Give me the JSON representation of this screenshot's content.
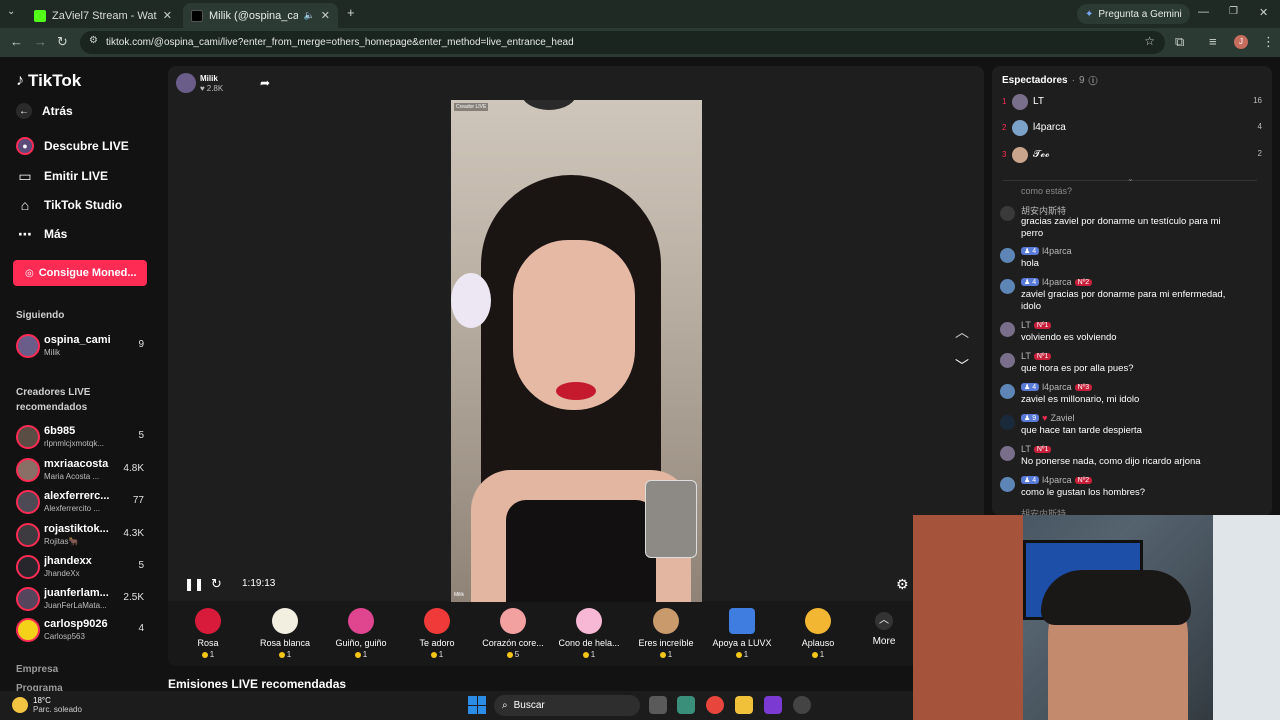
{
  "browser": {
    "tabs": [
      {
        "label": "ZaViel7 Stream - Watch Live on"
      },
      {
        "label": "Milik (@ospina_cami) está"
      }
    ],
    "gemini_label": "Pregunta a Gemini",
    "url": "tiktok.com/@ospina_cami/live?enter_from_merge=others_homepage&enter_method=live_entrance_head"
  },
  "sidebar": {
    "logo": "TikTok",
    "back": "Atrás",
    "nav": [
      {
        "label": "Descubre LIVE",
        "icon": "live-globe-icon"
      },
      {
        "label": "Emitir LIVE",
        "icon": "video-camera-icon"
      },
      {
        "label": "TikTok Studio",
        "icon": "home-icon"
      },
      {
        "label": "Más",
        "icon": "more-dots-icon"
      }
    ],
    "coins_button": "Consigue Moned...",
    "following_title": "Siguiendo",
    "following": [
      {
        "name": "ospina_cami",
        "sub": "Milik",
        "count": "9"
      }
    ],
    "recommended_title": "Creadores LIVE recomendados",
    "recommended": [
      {
        "name": "6b985",
        "sub": "rlpnmlcjxmotqk...",
        "count": "5"
      },
      {
        "name": "mxriaacosta",
        "sub": "Maria Acosta ...",
        "count": "4.8K"
      },
      {
        "name": "alexferrerc...",
        "sub": "Alexferrercito ...",
        "count": "77"
      },
      {
        "name": "rojastiktok...",
        "sub": "Rojitas🐂",
        "count": "4.3K"
      },
      {
        "name": "jhandexx",
        "sub": "JhandeXx",
        "count": "5"
      },
      {
        "name": "juanferlam...",
        "sub": "JuanFerLaMata...",
        "count": "2.5K"
      },
      {
        "name": "carlosp9026",
        "sub": "Carlosp563",
        "count": "4"
      }
    ],
    "footer": [
      "Empresa",
      "Programa"
    ]
  },
  "player": {
    "host_name": "Milik",
    "host_likes": "2.8K",
    "video_tag": "Creador LIVE",
    "video_footer": "Milik",
    "time": "1:19:13",
    "recommended_heading": "Emisiones LIVE recomendadas",
    "gifts": [
      {
        "name": "Rosa",
        "price": "1",
        "color": "#d81b3a"
      },
      {
        "name": "Rosa blanca",
        "price": "1",
        "color": "#f2efe1"
      },
      {
        "name": "Guiño, guiño",
        "price": "1",
        "color": "#e0458f"
      },
      {
        "name": "Te adoro",
        "price": "1",
        "color": "#f03a3a"
      },
      {
        "name": "Corazón core...",
        "price": "5",
        "color": "#f3a0a0"
      },
      {
        "name": "Cono de hela...",
        "price": "1",
        "color": "#f7b8d6"
      },
      {
        "name": "Eres increíble",
        "price": "1",
        "color": "#c99a6b"
      },
      {
        "name": "Apoya a LUVX",
        "price": "1",
        "color": "#3f7de0"
      },
      {
        "name": "Aplauso",
        "price": "1",
        "color": "#f2b632"
      }
    ],
    "more_label": "More"
  },
  "viewers": {
    "title": "Espectadores",
    "count": "9",
    "list": [
      {
        "rank": "1",
        "name": "LT",
        "value": "16"
      },
      {
        "rank": "2",
        "name": "l4parca",
        "value": "4"
      },
      {
        "rank": "3",
        "name": "𝓣𝓮𝓸",
        "value": "2"
      }
    ]
  },
  "chat": {
    "partial_top": "como estás?",
    "messages": [
      {
        "user": "胡安内斯特",
        "level": "",
        "badge": "",
        "text": "gracias zaviel por donarme un testículo para mi perro"
      },
      {
        "user": "l4parca",
        "level": "4",
        "badge": "",
        "text": "hola"
      },
      {
        "user": "l4parca",
        "level": "4",
        "badge": "Nº2",
        "text": "zaviel gracias por donarme para mi enfermedad, idolo"
      },
      {
        "user": "LT",
        "level": "",
        "badge": "Nº1",
        "text": "volviendo es volviendo"
      },
      {
        "user": "LT",
        "level": "",
        "badge": "Nº1",
        "text": "que hora es por alla pues?"
      },
      {
        "user": "l4parca",
        "level": "4",
        "badge": "Nº3",
        "text": "zaviel es millonario, mi idolo"
      },
      {
        "user": "Zaviel",
        "level": "9",
        "badge": "",
        "text": "que hace tan tarde despierta"
      },
      {
        "user": "LT",
        "level": "",
        "badge": "Nº1",
        "text": "No ponerse nada, como dijo ricardo arjona"
      },
      {
        "user": "l4parca",
        "level": "4",
        "badge": "Nº2",
        "text": "como le gustan los hombres?"
      }
    ],
    "partial_bottom": "胡安内斯特"
  },
  "taskbar": {
    "weather_temp": "18°C",
    "weather_desc": "Parc. soleado",
    "search_label": "Buscar"
  }
}
